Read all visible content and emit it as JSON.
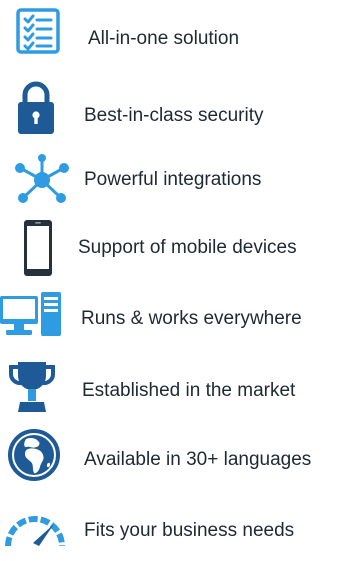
{
  "colors": {
    "icon_blue": "#1e5a96",
    "icon_light_blue": "#2f9be0",
    "icon_dark": "#25313d",
    "text": "#1f2933",
    "background": "#ffffff"
  },
  "features": [
    {
      "label": "All-in-one solution",
      "icon": "checklist-icon"
    },
    {
      "label": "Best-in-class security",
      "icon": "padlock-icon"
    },
    {
      "label": "Powerful integrations",
      "icon": "network-icon"
    },
    {
      "label": "Support of mobile devices",
      "icon": "smartphone-icon"
    },
    {
      "label": "Runs & works everywhere",
      "icon": "desktop-computer-icon"
    },
    {
      "label": "Established in the market",
      "icon": "trophy-icon"
    },
    {
      "label": "Available in 30+ languages",
      "icon": "globe-icon"
    },
    {
      "label": "Fits your business needs",
      "icon": "speedometer-icon"
    }
  ]
}
